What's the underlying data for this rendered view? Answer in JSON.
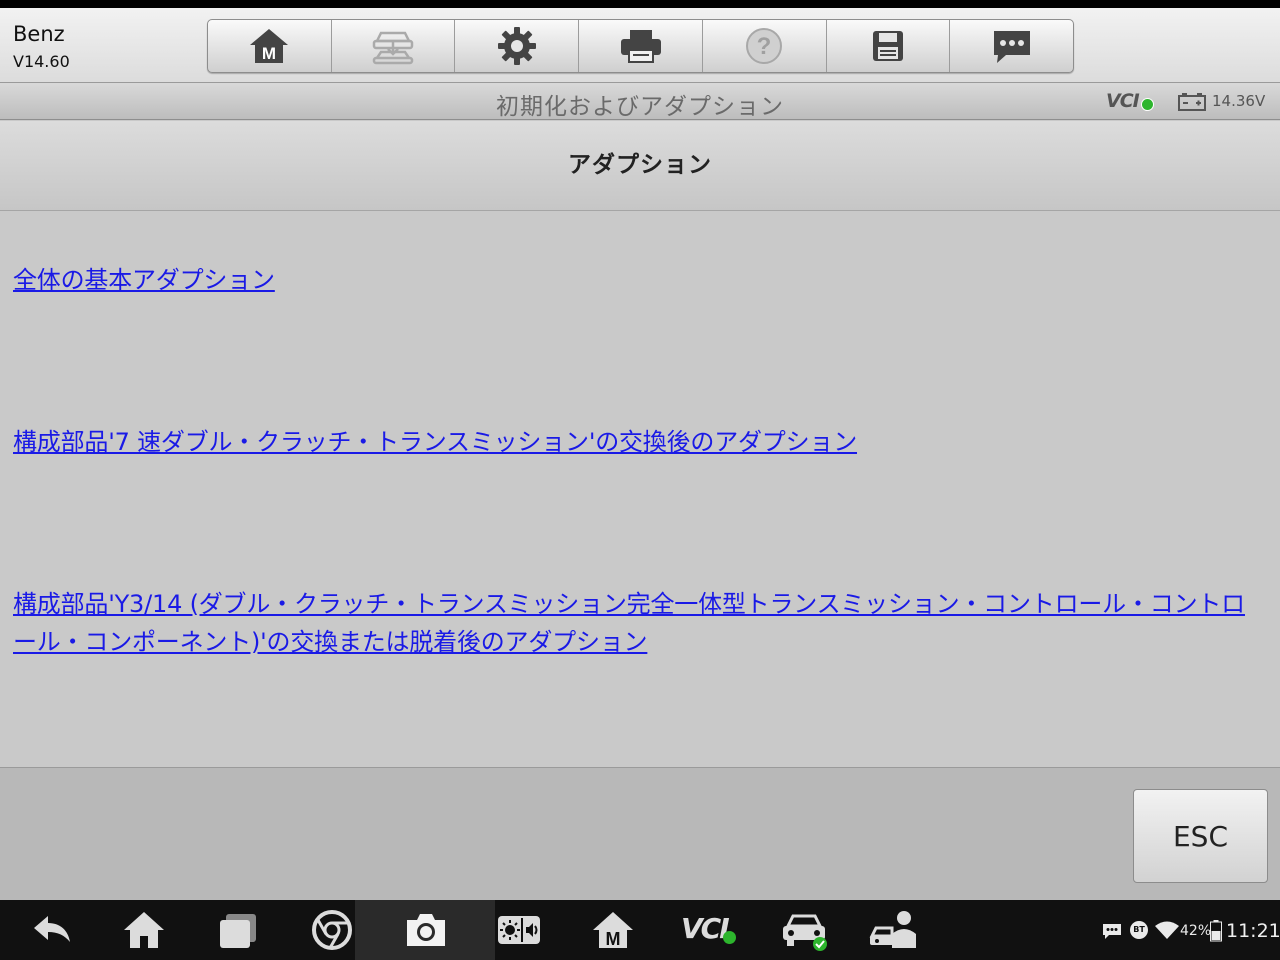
{
  "app": {
    "name": "Benz",
    "version": "V14.60"
  },
  "toolbar": {
    "buttons": [
      {
        "name": "home-m-icon",
        "label": "M"
      },
      {
        "name": "vehicle-swap-icon"
      },
      {
        "name": "gear-icon"
      },
      {
        "name": "printer-icon"
      },
      {
        "name": "help-icon",
        "label": "?"
      },
      {
        "name": "save-icon"
      },
      {
        "name": "message-icon"
      }
    ]
  },
  "titlebar": {
    "title": "初期化およびアダプション",
    "vci_label": "VCI",
    "voltage": "14.36V"
  },
  "section": {
    "title": "アダプション"
  },
  "links": [
    {
      "label": "全体の基本アダプション"
    },
    {
      "label": "構成部品'7 速ダブル・クラッチ・トランスミッション'の交換後のアダプション"
    },
    {
      "label": "構成部品'Y3/14 (ダブル・クラッチ・トランスミッション完全一体型トランスミッション・コントロール・コントロール・コンポーネント)'の交換または脱着後のアダプション"
    }
  ],
  "footer": {
    "esc_label": "ESC"
  },
  "system_nav": {
    "icons": [
      "back-icon",
      "home-icon",
      "recent-apps-icon",
      "chrome-icon",
      "camera-icon",
      "brightness-volume-icon",
      "maxisys-home-icon",
      "vci-icon",
      "car-check-icon",
      "mechanic-icon"
    ],
    "vci_label": "VCI"
  },
  "status": {
    "bt": "BT",
    "battery": "42%",
    "time": "11:21"
  },
  "colors": {
    "link": "#1a1ae6",
    "vci_ok": "#2db52d"
  }
}
